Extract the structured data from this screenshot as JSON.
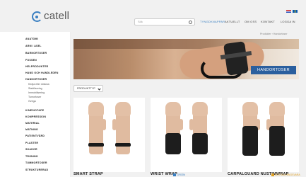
{
  "brand": {
    "name": "catell",
    "accent": "#3a7fc1"
  },
  "search": {
    "placeholder": "Sök"
  },
  "nav": [
    {
      "label": "TYNGDKNAPPAR",
      "active": true
    },
    {
      "label": "AKTUELLT",
      "active": false
    },
    {
      "label": "OM OSS",
      "active": false
    },
    {
      "label": "KONTAKT",
      "active": false
    },
    {
      "label": "LOGGA IN",
      "active": false
    }
  ],
  "sidebar": {
    "items": [
      "ANATOMI",
      "ARM / ASEL",
      "BARNORTOSER",
      "FOSSEN",
      "HELPRODUKTER",
      "HAND OCH HANDLEDEN",
      "HANDORTOSER"
    ],
    "subitems": [
      "Kedja eller sträcka",
      "Stabilisering",
      "Immobilisering",
      "Tumortoser",
      "Övriga"
    ],
    "items_after": [
      "KINESIOTAPE",
      "KOMPRESSION",
      "MATERIAL",
      "MATNING",
      "PATIENTVÅRD",
      "PLASTER",
      "SKADOR",
      "TRÄNING",
      "TUMMORTOSER",
      "STRUKTURERAD"
    ]
  },
  "breadcrumb": "Produkter › Handortoser",
  "hero": {
    "label": "HANDORTOSER"
  },
  "filter": {
    "label": "PRODUKTTYP"
  },
  "products": [
    {
      "title": "SMART STRAP",
      "tag": "",
      "tag_color": ""
    },
    {
      "title": "WRIST WRAP",
      "tag": "GRÖN",
      "tag_color": "#3a7fc1"
    },
    {
      "title": "CARPALGUARD NUSTIMWRAP",
      "tag": "BESTÄLLNINGSVARA",
      "tag_color": "#e0a020"
    }
  ]
}
